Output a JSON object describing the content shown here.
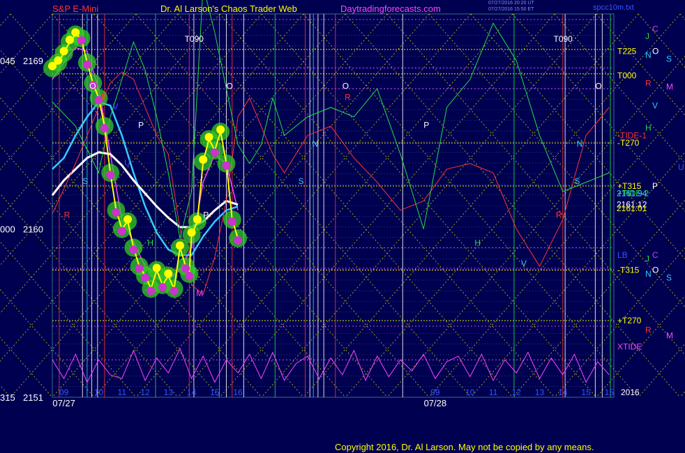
{
  "header": {
    "left": "S&P E-Mini",
    "center": "Dr. Al Larson's Chaos Trader Web",
    "site": "Daytradingforecasts.com",
    "stamp1": "07/27/2016 20:20 UT",
    "stamp2": "07/27/2016 15:50 ET",
    "file": "spcc10m.txt"
  },
  "footer": {
    "copyright": "Copyright 2016, Dr. Al Larson. May not be copied by any means."
  },
  "colors": {
    "background": "#000050",
    "price": "#ffff00",
    "ma_short": "#ff44ff",
    "ma_mid": "#33ccff",
    "ma_long": "#ffffff",
    "tide1": "#ff3333",
    "tide2": "#22dd44",
    "xtide": "#ff44ff",
    "electric_lines": "#e8e800",
    "flux": "#3a6a8a"
  },
  "chart_data": {
    "type": "line",
    "title": "S&P E-Mini",
    "ylim": [
      2151,
      2171.5
    ],
    "y_ticks": [
      {
        "value": 2169,
        "left": "045",
        "right": "2169"
      },
      {
        "value": 2160,
        "left": "000",
        "right": "2160"
      },
      {
        "value": 2151,
        "left": "315",
        "right": "2151"
      }
    ],
    "x_ticks": [
      {
        "x": 8.5,
        "label": "09"
      },
      {
        "x": 10,
        "label": "10"
      },
      {
        "x": 11,
        "label": "11"
      },
      {
        "x": 12,
        "label": "12"
      },
      {
        "x": 13,
        "label": "13"
      },
      {
        "x": 14,
        "label": "14"
      },
      {
        "x": 15,
        "label": "15"
      },
      {
        "x": 16,
        "label": "16"
      },
      {
        "x": 24.5,
        "label": "09"
      },
      {
        "x": 26,
        "label": "10"
      },
      {
        "x": 27,
        "label": "11"
      },
      {
        "x": 28,
        "label": "12"
      },
      {
        "x": 29,
        "label": "13"
      },
      {
        "x": 30,
        "label": "14"
      },
      {
        "x": 31,
        "label": "15"
      },
      {
        "x": 32,
        "label": "15"
      }
    ],
    "date_labels": [
      {
        "x": 8.5,
        "label": "07/27"
      },
      {
        "x": 24.5,
        "label": "07/28"
      }
    ],
    "year_label": "2016",
    "x_range": [
      8,
      32.2
    ],
    "price_series": {
      "name": "S&P E-Mini 1-minute",
      "x": [
        8.0,
        8.25,
        8.5,
        8.75,
        9.0,
        9.25,
        9.5,
        9.75,
        10.0,
        10.25,
        10.5,
        10.75,
        11.0,
        11.25,
        11.5,
        11.75,
        12.0,
        12.25,
        12.5,
        12.75,
        13.0,
        13.25,
        13.5,
        13.75,
        13.9,
        14.0,
        14.25,
        14.5,
        14.75,
        15.0,
        15.25,
        15.5,
        15.75,
        16.0
      ],
      "y": [
        2168.6,
        2168.9,
        2169.4,
        2170.0,
        2170.4,
        2170.2,
        2168.9,
        2167.8,
        2167.0,
        2165.5,
        2163.0,
        2161.0,
        2160.0,
        2160.4,
        2159.0,
        2158.0,
        2157.5,
        2156.8,
        2157.8,
        2157.0,
        2157.5,
        2156.8,
        2159.0,
        2158.0,
        2157.6,
        2159.7,
        2160.4,
        2163.6,
        2164.8,
        2164.2,
        2165.2,
        2163.5,
        2160.5,
        2159.5
      ]
    },
    "indicators": [
      {
        "name": "MA short",
        "x": [
          8,
          8.5,
          9,
          9.5,
          10,
          10.5,
          11,
          11.5,
          12,
          12.5,
          13,
          13.5,
          14,
          14.5,
          15,
          15.5,
          16
        ],
        "y": [
          2168.0,
          2168.9,
          2169.7,
          2169.5,
          2167.5,
          2164.0,
          2160.5,
          2159.3,
          2158.0,
          2157.6,
          2157.3,
          2157.8,
          2159.0,
          2162.5,
          2164.0,
          2163.5,
          2161.0
        ]
      },
      {
        "name": "MA mid",
        "x": [
          8,
          8.5,
          9,
          9.5,
          10,
          10.5,
          11,
          11.5,
          12,
          12.5,
          13,
          13.5,
          14,
          14.5,
          15,
          15.5,
          16
        ],
        "y": [
          2163.2,
          2163.8,
          2165.0,
          2166.0,
          2166.8,
          2166.6,
          2165.0,
          2163.0,
          2161.2,
          2159.8,
          2158.9,
          2158.6,
          2158.6,
          2159.6,
          2160.4,
          2161.0,
          2161.2
        ]
      },
      {
        "name": "MA long",
        "x": [
          8,
          8.5,
          9,
          9.5,
          10,
          10.5,
          11,
          11.5,
          12,
          12.5,
          13,
          13.5,
          14,
          14.5,
          15,
          15.5,
          16
        ],
        "y": [
          2161.8,
          2162.6,
          2163.2,
          2163.8,
          2164.1,
          2164.0,
          2163.4,
          2162.6,
          2161.9,
          2161.2,
          2160.6,
          2160.1,
          2160.1,
          2160.4,
          2161.0,
          2161.5,
          2161.3
        ]
      },
      {
        "name": "TIDE-1",
        "x": [
          8,
          9,
          10,
          10.5,
          11,
          11.5,
          12,
          12.5,
          13,
          13.5,
          14,
          14.5,
          15,
          15.5,
          16,
          16.5,
          17,
          17.5,
          18,
          19,
          20,
          21,
          22,
          23,
          24,
          25,
          26,
          27,
          28,
          29,
          30,
          31,
          32
        ],
        "y": [
          2160.8,
          2163.5,
          2166.5,
          2167.8,
          2168.4,
          2168.0,
          2166.5,
          2165.0,
          2164.0,
          2160.0,
          2157.0,
          2156.5,
          2158.5,
          2161.5,
          2166.0,
          2167.0,
          2165.5,
          2164.0,
          2163.0,
          2165.0,
          2165.5,
          2163.8,
          2162.5,
          2161.0,
          2161.5,
          2163.2,
          2163.5,
          2163.0,
          2160.0,
          2158.0,
          2160.5,
          2165.0,
          2166.5
        ]
      },
      {
        "name": "TIDE-2",
        "x": [
          8,
          9,
          10,
          10.5,
          11,
          11.5,
          12,
          12.5,
          13,
          13.5,
          14,
          14.5,
          15,
          15.5,
          16,
          16.5,
          17,
          17.5,
          18,
          19,
          20,
          21,
          22,
          23,
          24,
          25,
          26,
          27,
          28,
          29,
          30,
          31,
          32
        ],
        "y": [
          2166.8,
          2165.5,
          2163.0,
          2166.0,
          2168.0,
          2170.0,
          2168.5,
          2166.0,
          2163.0,
          2159.5,
          2162.0,
          2173.0,
          2170.5,
          2167.5,
          2164.5,
          2163.5,
          2164.5,
          2167.0,
          2165.0,
          2166.0,
          2166.5,
          2166.0,
          2167.5,
          2164.0,
          2160.0,
          2166.5,
          2168.0,
          2171.0,
          2169.0,
          2165.0,
          2162.0,
          2162.5,
          2163.0
        ]
      },
      {
        "name": "XTIDE",
        "x": [
          8,
          8.5,
          9,
          9.5,
          10,
          10.5,
          11,
          11.5,
          12,
          12.5,
          13,
          13.5,
          14,
          14.5,
          15,
          15.5,
          16,
          16.5,
          17,
          17.5,
          18,
          18.5,
          19,
          19.5,
          20,
          20.5,
          21,
          21.5,
          22,
          22.5,
          23,
          23.5,
          24,
          24.5,
          25,
          25.5,
          26,
          26.5,
          27,
          27.5,
          28,
          28.5,
          29,
          29.5,
          30,
          30.5,
          31,
          31.5,
          32
        ],
        "y": [
          2153.0,
          2152.0,
          2153.3,
          2151.8,
          2153.0,
          2152.2,
          2152.0,
          2153.5,
          2151.9,
          2153.1,
          2152.3,
          2153.6,
          2152.0,
          2153.2,
          2151.8,
          2153.0,
          2152.3,
          2153.3,
          2152.0,
          2153.4,
          2151.9,
          2152.8,
          2153.2,
          2152.0,
          2153.1,
          2152.2,
          2153.5,
          2151.9,
          2153.2,
          2152.1,
          2153.0,
          2152.4,
          2153.3,
          2152.0,
          2152.9,
          2153.2,
          2152.1,
          2153.3,
          2151.9,
          2153.0,
          2152.3,
          2153.4,
          2152.0,
          2153.1,
          2152.2,
          2153.3,
          2151.8,
          2152.9,
          2152.2
        ]
      }
    ],
    "right_labels": [
      {
        "value": 2170.7,
        "label": "C",
        "color": "#cc44ff"
      },
      {
        "value": 2170.3,
        "label": "J",
        "color": "#22dd44"
      },
      {
        "value": 2169.5,
        "label": "T225",
        "color": "#ffff00"
      },
      {
        "value": 2169.5,
        "label": "O",
        "color": "#ffffff"
      },
      {
        "value": 2169.3,
        "label": "N",
        "color": "#33ccff"
      },
      {
        "value": 2169.1,
        "label": "S",
        "color": "#33ccff"
      },
      {
        "value": 2168.2,
        "label": "T000",
        "color": "#ffff00"
      },
      {
        "value": 2167.8,
        "label": "R",
        "color": "#ff3333"
      },
      {
        "value": 2167.6,
        "label": "M",
        "color": "#ff44ff"
      },
      {
        "value": 2166.6,
        "label": "V",
        "color": "#33ccff"
      },
      {
        "value": 2165.4,
        "label": "H",
        "color": "#22dd44"
      },
      {
        "value": 2165.0,
        "label": "-TIDE-1",
        "color": "#ff3333"
      },
      {
        "value": 2164.6,
        "label": "-T270",
        "color": "#ffff00"
      },
      {
        "value": 2163.3,
        "label": "U",
        "color": "#3355ff"
      },
      {
        "value": 2162.3,
        "label": "+T315",
        "color": "#ffff00"
      },
      {
        "value": 2162.3,
        "label": "P",
        "color": "#ffffff"
      },
      {
        "value": 2161.9,
        "label": "+TIDE-2",
        "color": "#22dd44"
      },
      {
        "value": 2161.9,
        "label": "2161.94",
        "color": "#33ccff"
      },
      {
        "value": 2161.3,
        "label": "2161.12",
        "color": "#ffffff"
      },
      {
        "value": 2161.1,
        "label": "2161.01",
        "color": "#ffff00"
      },
      {
        "value": 2158.6,
        "label": "LB",
        "color": "#3355ff"
      },
      {
        "value": 2158.6,
        "label": "C",
        "color": "#cc44ff"
      },
      {
        "value": 2158.4,
        "label": "J",
        "color": "#22dd44"
      },
      {
        "value": 2157.8,
        "label": "-T315",
        "color": "#ffff00"
      },
      {
        "value": 2157.8,
        "label": "O",
        "color": "#ffffff"
      },
      {
        "value": 2157.6,
        "label": "N",
        "color": "#33ccff"
      },
      {
        "value": 2157.4,
        "label": "S",
        "color": "#33ccff"
      },
      {
        "value": 2155.1,
        "label": "+T270",
        "color": "#ffff00"
      },
      {
        "value": 2154.6,
        "label": "R",
        "color": "#ff3333"
      },
      {
        "value": 2154.3,
        "label": "M",
        "color": "#ff44ff"
      },
      {
        "value": 2153.7,
        "label": "XTIDE",
        "color": "#ff44ff"
      }
    ],
    "chart_labels": [
      {
        "x": 13.7,
        "y": 2170.0,
        "label": "T090",
        "color": "#ffffff"
      },
      {
        "x": 29.6,
        "y": 2170.0,
        "label": "T090",
        "color": "#ffffff"
      },
      {
        "x": 9.6,
        "y": 2167.5,
        "label": "O",
        "color": "#ffffff"
      },
      {
        "x": 15.5,
        "y": 2167.5,
        "label": "O",
        "color": "#ffffff"
      },
      {
        "x": 20.5,
        "y": 2167.5,
        "label": "O",
        "color": "#ffffff"
      },
      {
        "x": 31.4,
        "y": 2167.5,
        "label": "O",
        "color": "#ffffff"
      },
      {
        "x": 10.1,
        "y": 2166.9,
        "label": "R",
        "color": "#ff3333"
      },
      {
        "x": 20.6,
        "y": 2166.9,
        "label": "R",
        "color": "#ff3333"
      },
      {
        "x": 10.6,
        "y": 2166.4,
        "label": "V",
        "color": "#3355ff"
      },
      {
        "x": 11.7,
        "y": 2165.4,
        "label": "P",
        "color": "#ffffff"
      },
      {
        "x": 24.0,
        "y": 2165.4,
        "label": "P",
        "color": "#ffffff"
      },
      {
        "x": 19.2,
        "y": 2164.4,
        "label": "N",
        "color": "#33ccff"
      },
      {
        "x": 30.6,
        "y": 2164.4,
        "label": "N",
        "color": "#33ccff"
      },
      {
        "x": 11.1,
        "y": 2163.4,
        "label": "U",
        "color": "#3355ff"
      },
      {
        "x": 9.3,
        "y": 2162.4,
        "label": "S",
        "color": "#33ccff"
      },
      {
        "x": 18.6,
        "y": 2162.4,
        "label": "S",
        "color": "#33ccff"
      },
      {
        "x": 30.5,
        "y": 2162.4,
        "label": "S",
        "color": "#33ccff"
      },
      {
        "x": 8.5,
        "y": 2160.6,
        "label": "R",
        "color": "#ff3333"
      },
      {
        "x": 14.5,
        "y": 2160.6,
        "label": "P",
        "color": "#ffffff"
      },
      {
        "x": 29.7,
        "y": 2160.6,
        "label": "R",
        "color": "#ff3333"
      },
      {
        "x": 12.1,
        "y": 2159.1,
        "label": "H",
        "color": "#22dd44"
      },
      {
        "x": 26.2,
        "y": 2159.1,
        "label": "H",
        "color": "#22dd44"
      },
      {
        "x": 14.2,
        "y": 2156.4,
        "label": "M",
        "color": "#ff44ff"
      },
      {
        "x": 14.0,
        "y": 2157.6,
        "label": "J",
        "color": "#22dd44"
      },
      {
        "x": 28.2,
        "y": 2158.0,
        "label": "V",
        "color": "#33ccff"
      }
    ]
  }
}
